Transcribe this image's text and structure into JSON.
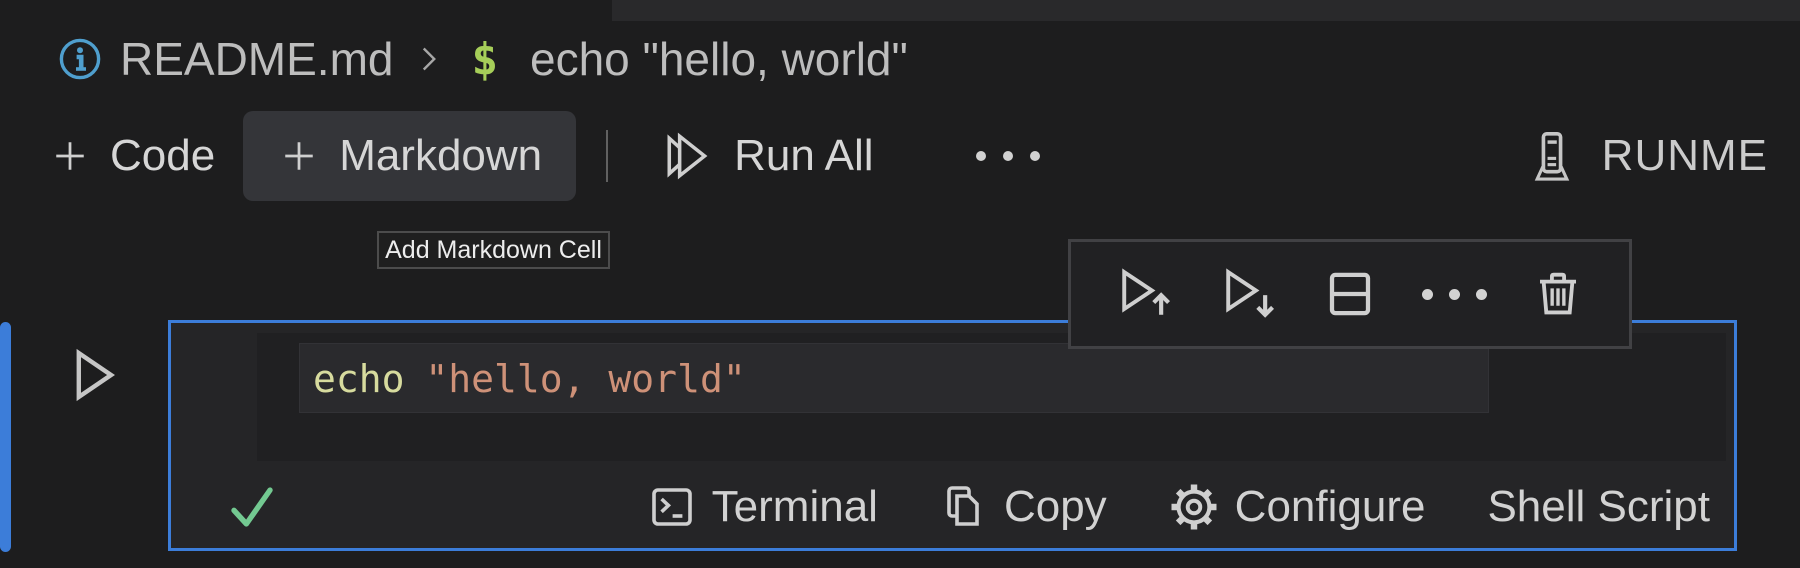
{
  "breadcrumb": {
    "file_name": "README.md",
    "separator": ">",
    "language_symbol": "$",
    "command_preview": "echo \"hello, world\""
  },
  "toolbar": {
    "code_label": "Code",
    "markdown_label": "Markdown",
    "run_all_label": "Run All",
    "runme_label": "RUNME"
  },
  "tooltip": {
    "text": "Add Markdown Cell"
  },
  "cell_toolbar": {
    "icons": [
      "execute-above-icon",
      "execute-cell-and-below-icon",
      "split-cell-icon",
      "more-actions-icon",
      "delete-cell-icon"
    ]
  },
  "cell": {
    "code": {
      "keyword": "echo",
      "string": "\"hello, world\""
    },
    "status_bar": {
      "success_icon": "check-icon",
      "terminal_label": "Terminal",
      "copy_label": "Copy",
      "configure_label": "Configure",
      "language_label": "Shell Script"
    }
  },
  "icons": {
    "breadcrumb_info": "info-icon",
    "breadcrumb_chevron": "chevron-right-icon",
    "add": "plus-icon",
    "run_all": "run-all-icon",
    "toolbar_more": "ellipsis-icon",
    "brand": "runme-logo-icon",
    "run_cell": "play-icon",
    "terminal": "terminal-icon",
    "copy": "copy-icon",
    "configure": "gear-icon",
    "delete": "trash-icon"
  },
  "colors": {
    "accent_blue": "#3c7dd9",
    "success_green": "#73c991",
    "shell_green": "#a6ce59",
    "info_blue": "#4f9fce",
    "keyword_yellow": "#d7db9e",
    "string_orange": "#ce9178",
    "background": "#1d1d1e",
    "cell_background": "#252527",
    "hover_button_background": "#343539"
  }
}
